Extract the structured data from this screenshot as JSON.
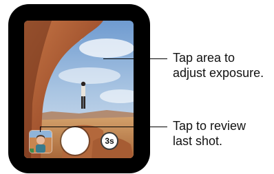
{
  "camera": {
    "timer_label": "3s",
    "controls": {
      "thumbnail": "last-shot-thumbnail",
      "shutter": "shutter-button",
      "timer": "timer-button"
    }
  },
  "callouts": [
    {
      "line1": "Tap area to",
      "line2": "adjust exposure."
    },
    {
      "line1": "Tap to review",
      "line2": "last shot."
    }
  ],
  "colors": {
    "sky": "#8fb4d9",
    "rock": "#b5653a",
    "ground": "#c98a55",
    "watch_body": "#000000"
  }
}
